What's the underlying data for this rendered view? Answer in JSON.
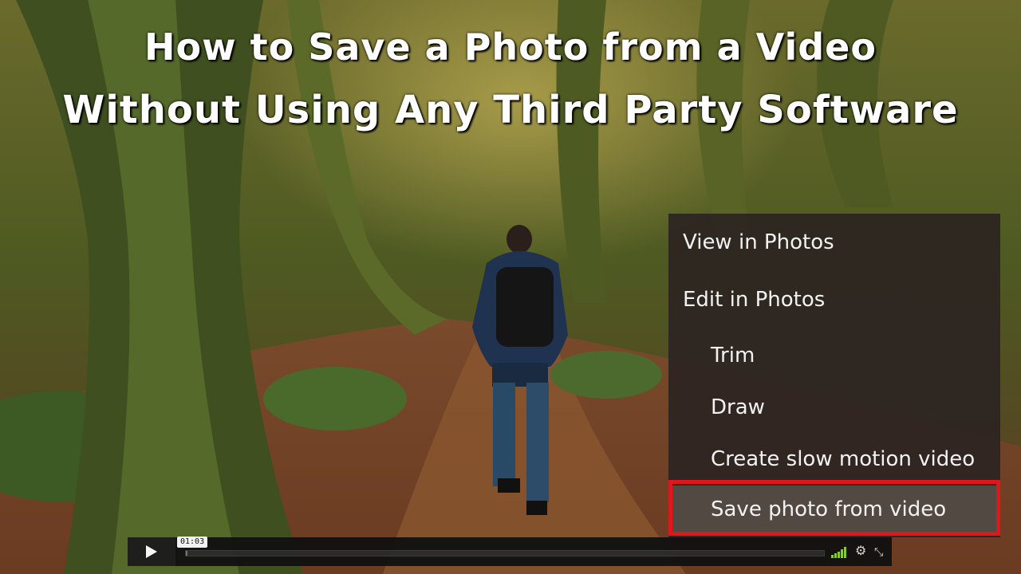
{
  "video": {
    "title_line1": "How to Save a Photo from a Video",
    "title_line2": "Without Using Any Third Party Software"
  },
  "context_menu": {
    "items": [
      {
        "label": "View in Photos",
        "level": "top"
      },
      {
        "label": "Edit in Photos",
        "level": "top"
      },
      {
        "label": "Trim",
        "level": "sub"
      },
      {
        "label": "Draw",
        "level": "sub"
      },
      {
        "label": "Create slow motion video",
        "level": "sub"
      },
      {
        "label": "Save photo from video",
        "level": "sub",
        "highlighted": true
      }
    ],
    "highlight_color": "#e0161a"
  },
  "player": {
    "time": "01:03",
    "progress_fraction": 0.003,
    "icons": [
      "play-icon",
      "signal-icon",
      "gear-icon",
      "fullscreen-icon"
    ]
  }
}
